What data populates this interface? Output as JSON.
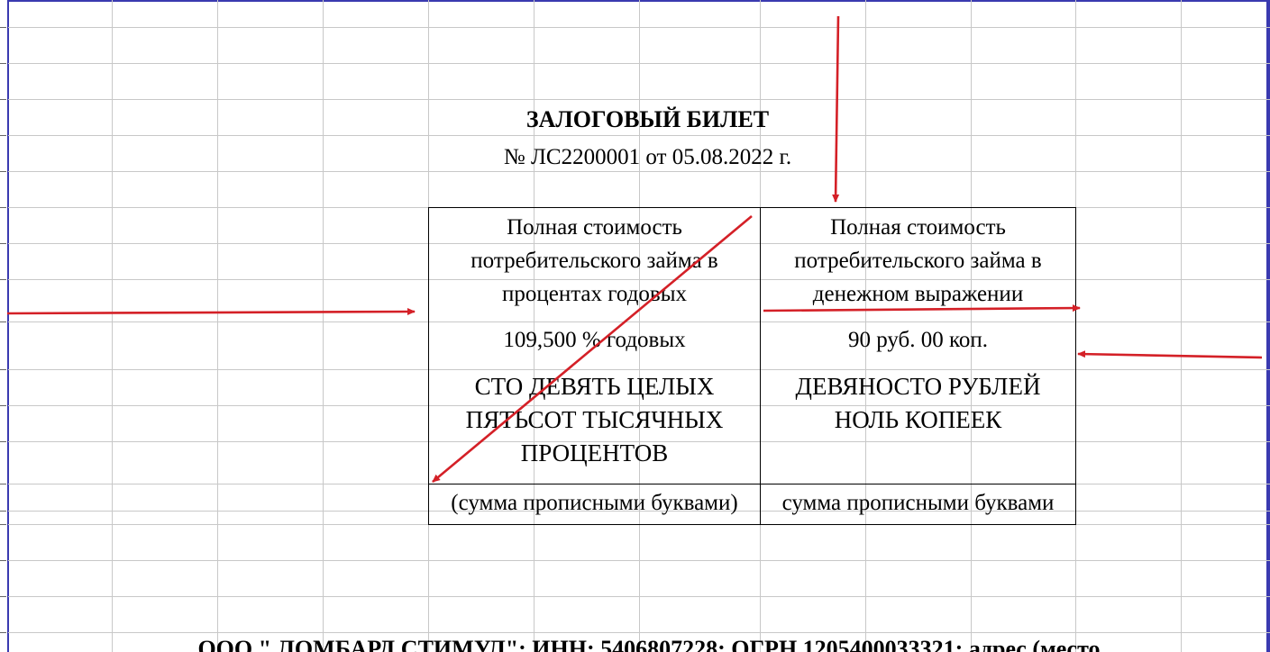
{
  "document": {
    "title": "ЗАЛОГОВЫЙ БИЛЕТ",
    "subtitle": "№ ЛС2200001 от 05.08.2022 г."
  },
  "table": {
    "left": {
      "header": "Полная стоимость потребительского займа в процентах годовых",
      "value": "109,500 % годовых",
      "words": "СТО ДЕВЯТЬ ЦЕЛЫХ ПЯТЬСОТ ТЫСЯЧНЫХ ПРОЦЕНТОВ",
      "caption": "(сумма прописными буквами)"
    },
    "right": {
      "header": "Полная стоимость потребительского займа в денежном выражении",
      "value": "90 руб. 00 коп.",
      "words": "ДЕВЯНОСТО РУБЛЕЙ НОЛЬ КОПЕЕК",
      "caption": "сумма прописными буквами"
    }
  },
  "footer": {
    "text": "ООО \" ЛОМБАРД СТИМУЛ\"; ИНН: 5406807228; ОГРН 1205400033321; адрес (место"
  },
  "colors": {
    "annotation_arrows": "#d42027",
    "grid": "#c8c8c8",
    "frame": "#3a3ab0"
  }
}
